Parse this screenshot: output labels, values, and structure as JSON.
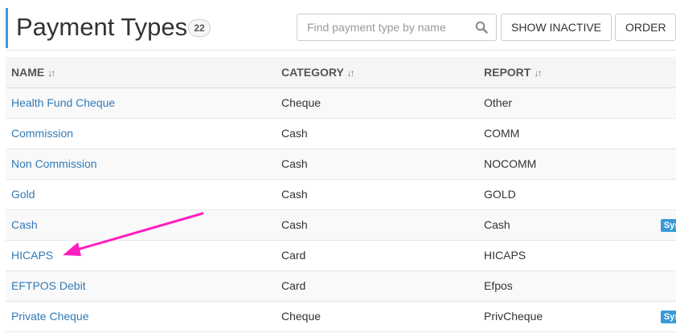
{
  "header": {
    "title": "Payment Types",
    "count": "22",
    "search_placeholder": "Find payment type by name",
    "search_value": "",
    "show_inactive_label": "SHOW INACTIVE",
    "order_label": "ORDER"
  },
  "table": {
    "columns": [
      {
        "label": "NAME",
        "sort_icon": "sort-icon"
      },
      {
        "label": "CATEGORY",
        "sort_icon": "sort-icon"
      },
      {
        "label": "REPORT",
        "sort_icon": "sort-icon"
      }
    ],
    "rows": [
      {
        "name": "Health Fund Cheque",
        "category": "Cheque",
        "report": "Other",
        "badge": ""
      },
      {
        "name": "Commission",
        "category": "Cash",
        "report": "COMM",
        "badge": ""
      },
      {
        "name": "Non Commission",
        "category": "Cash",
        "report": "NOCOMM",
        "badge": ""
      },
      {
        "name": "Gold",
        "category": "Cash",
        "report": "GOLD",
        "badge": ""
      },
      {
        "name": "Cash",
        "category": "Cash",
        "report": "Cash",
        "badge": "System"
      },
      {
        "name": "HICAPS",
        "category": "Card",
        "report": "HICAPS",
        "badge": ""
      },
      {
        "name": "EFTPOS Debit",
        "category": "Card",
        "report": "Efpos",
        "badge": ""
      },
      {
        "name": "Private Cheque",
        "category": "Cheque",
        "report": "PrivCheque",
        "badge": "System"
      }
    ]
  },
  "colors": {
    "accent": "#3a9ad9",
    "link": "#337ab7",
    "annotation_arrow": "#ff1fc1"
  }
}
